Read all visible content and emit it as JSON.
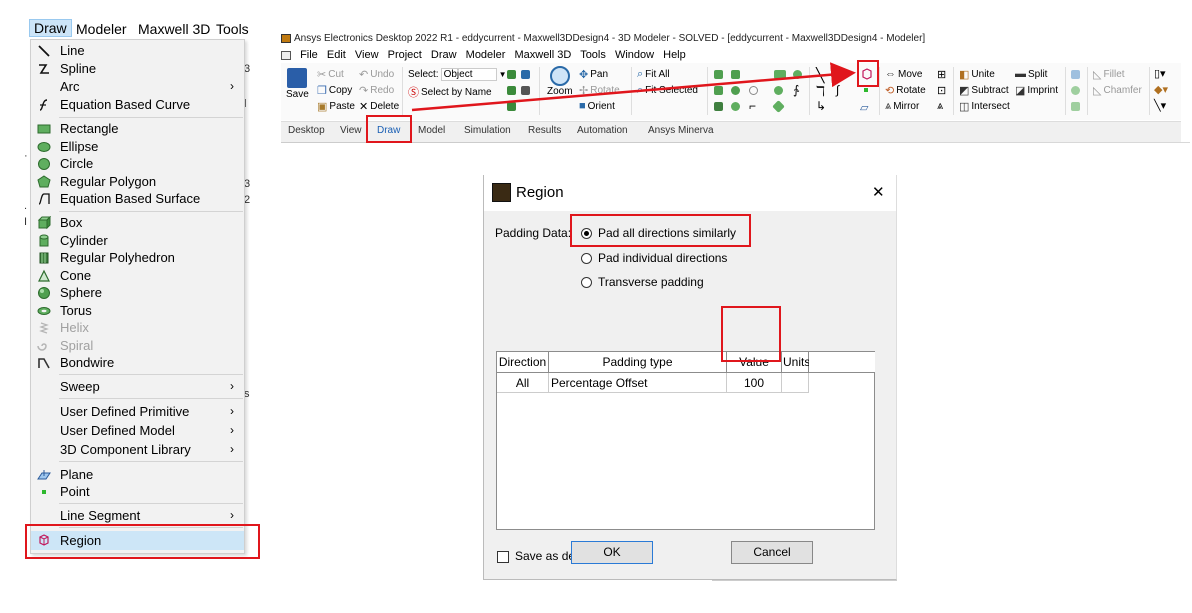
{
  "draw_menubar": {
    "items": [
      "Draw",
      "Modeler",
      "Maxwell 3D",
      "Tools"
    ]
  },
  "draw_menu": {
    "items": [
      {
        "label": "Line",
        "icon": "line-icon"
      },
      {
        "label": "Spline",
        "icon": "spline-icon"
      },
      {
        "label": "Arc",
        "icon": "",
        "submenu": true
      },
      {
        "label": "Equation Based Curve",
        "icon": "equation-curve-icon"
      },
      {
        "label": "Rectangle",
        "icon": "rectangle-icon"
      },
      {
        "label": "Ellipse",
        "icon": "ellipse-icon"
      },
      {
        "label": "Circle",
        "icon": "circle-icon"
      },
      {
        "label": "Regular Polygon",
        "icon": "regular-polygon-icon"
      },
      {
        "label": "Equation Based Surface",
        "icon": "equation-surface-icon"
      },
      {
        "label": "Box",
        "icon": "box-icon"
      },
      {
        "label": "Cylinder",
        "icon": "cylinder-icon"
      },
      {
        "label": "Regular Polyhedron",
        "icon": "regular-polyhedron-icon"
      },
      {
        "label": "Cone",
        "icon": "cone-icon"
      },
      {
        "label": "Sphere",
        "icon": "sphere-icon"
      },
      {
        "label": "Torus",
        "icon": "torus-icon"
      },
      {
        "label": "Helix",
        "icon": "helix-icon",
        "disabled": true
      },
      {
        "label": "Spiral",
        "icon": "spiral-icon",
        "disabled": true
      },
      {
        "label": "Bondwire",
        "icon": "bondwire-icon"
      },
      {
        "label": "Sweep",
        "icon": "",
        "submenu": true
      },
      {
        "label": "User Defined Primitive",
        "icon": "",
        "submenu": true
      },
      {
        "label": "User Defined Model",
        "icon": "",
        "submenu": true
      },
      {
        "label": "3D Component Library",
        "icon": "",
        "submenu": true
      },
      {
        "label": "Plane",
        "icon": "plane-icon"
      },
      {
        "label": "Point",
        "icon": "point-icon"
      },
      {
        "label": "Line Segment",
        "icon": "",
        "submenu": true
      },
      {
        "label": "Region",
        "icon": "region-icon",
        "selected": true
      }
    ],
    "submenu_arrow": "›"
  },
  "app": {
    "title": "Ansys Electronics Desktop 2022 R1 - eddycurrent - Maxwell3DDesign4 - 3D Modeler - SOLVED - [eddycurrent - Maxwell3DDesign4 - Modeler]",
    "menu": [
      "File",
      "Edit",
      "View",
      "Project",
      "Draw",
      "Modeler",
      "Maxwell 3D",
      "Tools",
      "Window",
      "Help"
    ]
  },
  "ribbon": {
    "save": "Save",
    "cut": "Cut",
    "copy": "Copy",
    "paste": "Paste",
    "undo": "Undo",
    "redo": "Redo",
    "delete": "Delete",
    "select_label": "Select:",
    "select_value": "Object",
    "select_by_name": "Select by Name",
    "zoom": "Zoom",
    "pan": "Pan",
    "rotate": "Rotate",
    "orient": "Orient",
    "fit_all": "Fit All",
    "fit_selected": "Fit Selected",
    "move": "Move",
    "rotate2": "Rotate",
    "mirror": "Mirror",
    "unite": "Unite",
    "subtract": "Subtract",
    "intersect": "Intersect",
    "split": "Split",
    "imprint": "Imprint",
    "fillet": "Fillet",
    "chamfer": "Chamfer"
  },
  "tabs": [
    "Desktop",
    "View",
    "Draw",
    "Model",
    "Simulation",
    "Results",
    "Automation",
    "Ansys Minerva"
  ],
  "dialog": {
    "title": "Region",
    "close": "✕",
    "padding_label": "Padding Data:",
    "options": [
      "Pad all directions similarly",
      "Pad individual directions",
      "Transverse padding"
    ],
    "selected_option": 0,
    "columns": [
      "Direction",
      "Padding type",
      "Value",
      "Units"
    ],
    "rows": [
      [
        "All",
        "Percentage Offset",
        "100",
        ""
      ]
    ],
    "save_default": "Save as default",
    "ok": "OK",
    "cancel": "Cancel"
  },
  "colors": {
    "highlight": "#e0161c",
    "menu_bg": "#f2f2f2",
    "selection": "#cde6f7",
    "active_tab": "#1a5fb4"
  }
}
